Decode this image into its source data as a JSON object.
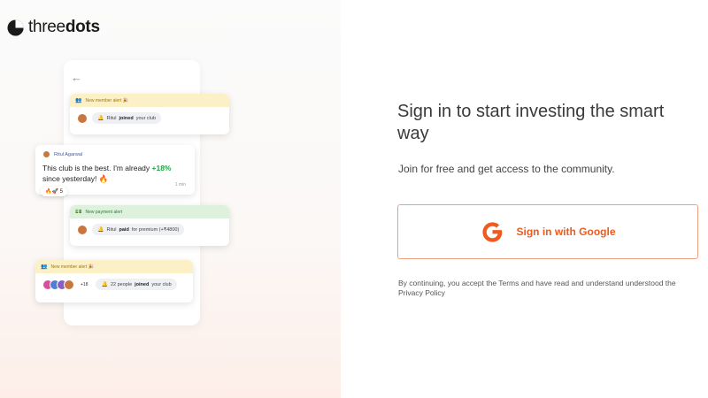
{
  "brand": {
    "name_light": "three",
    "name_bold": "dots",
    "logo_icon": "threedots-logo-icon"
  },
  "illustration": {
    "back_icon": "←",
    "member_card_top": {
      "header": "New member alert 🎉",
      "user": "Ritul",
      "action": "joined",
      "suffix": "your club"
    },
    "chat": {
      "author": "Ritul Agarwal",
      "message_prefix": "This club is the best. I'm already ",
      "gain": "+18%",
      "message_suffix": " since yesterday! 🔥",
      "time": "1 min",
      "reactions": "🔥🚀 5"
    },
    "payment_card": {
      "header": "New payment alert",
      "user": "Ritul",
      "action": "paid",
      "suffix": "for premium (+₹4800)"
    },
    "member_card_bottom": {
      "header": "New member alert 🎉",
      "more": "+18",
      "prefix": "22 people",
      "action": "joined",
      "suffix": "your club"
    }
  },
  "signin": {
    "heading": "Sign in to start investing the smart way",
    "subheading": "Join for free and get access to the community.",
    "google_button_label": "Sign in with Google",
    "terms": "By continuing, you accept the Terms and have read and understand understood the Privacy Policy"
  },
  "colors": {
    "accent": "#ef5b1e",
    "button_border": "#f1a07f",
    "gain_green": "#22a447"
  }
}
